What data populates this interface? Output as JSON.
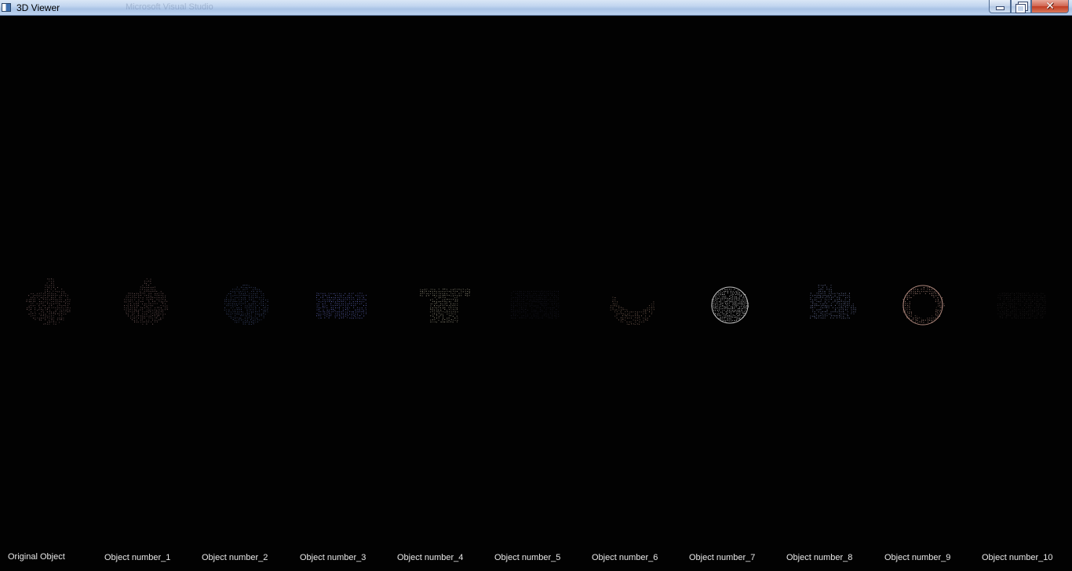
{
  "window": {
    "title": "3D Viewer",
    "ghost_text": [
      "Microsoft Visual Studio"
    ],
    "controls": {
      "minimize_icon": "minimize-icon",
      "restore_icon": "restore-icon",
      "close_icon": "close-icon"
    }
  },
  "viewport": {
    "background": "#020202",
    "objects": [
      {
        "label": "Original Object",
        "shape": "blob-leaf",
        "color": "#8a6b6b"
      },
      {
        "label": "Object number_1",
        "shape": "blob-leaf",
        "color": "#8a6b6b"
      },
      {
        "label": "Object number_2",
        "shape": "sphere-dark",
        "color": "#4a5a8a"
      },
      {
        "label": "Object number_3",
        "shape": "cushion",
        "color": "#6f78d8"
      },
      {
        "label": "Object number_4",
        "shape": "tshirt",
        "color": "#b8b29a"
      },
      {
        "label": "Object number_5",
        "shape": "blob-dim",
        "color": "#2c2c44"
      },
      {
        "label": "Object number_6",
        "shape": "crescent",
        "color": "#9a7a6a"
      },
      {
        "label": "Object number_7",
        "shape": "disc",
        "color": "#f2f2f2"
      },
      {
        "label": "Object number_8",
        "shape": "jagged",
        "color": "#8894c8"
      },
      {
        "label": "Object number_9",
        "shape": "ring",
        "color": "#d8a89a"
      },
      {
        "label": "Object number_10",
        "shape": "faint",
        "color": "#3a3436"
      }
    ]
  }
}
